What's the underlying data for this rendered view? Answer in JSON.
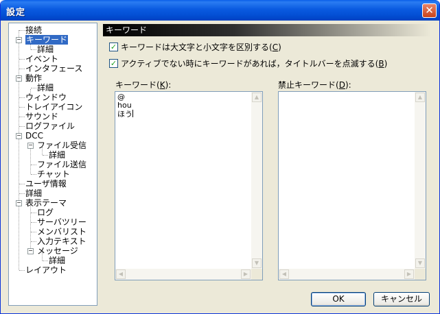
{
  "window": {
    "title": "設定"
  },
  "tree": {
    "items": [
      {
        "label": "接続"
      },
      {
        "label": "キーワード"
      },
      {
        "label": "詳細"
      },
      {
        "label": "イベント"
      },
      {
        "label": "インタフェース"
      },
      {
        "label": "動作"
      },
      {
        "label": "詳細"
      },
      {
        "label": "ウィンドウ"
      },
      {
        "label": "トレイアイコン"
      },
      {
        "label": "サウンド"
      },
      {
        "label": "ログファイル"
      },
      {
        "label": "DCC"
      },
      {
        "label": "ファイル受信"
      },
      {
        "label": "詳細"
      },
      {
        "label": "ファイル送信"
      },
      {
        "label": "チャット"
      },
      {
        "label": "ユーザ情報"
      },
      {
        "label": "詳細"
      },
      {
        "label": "表示テーマ"
      },
      {
        "label": "ログ"
      },
      {
        "label": "サーバツリー"
      },
      {
        "label": "メンバリスト"
      },
      {
        "label": "入力テキスト"
      },
      {
        "label": "メッセージ"
      },
      {
        "label": "詳細"
      },
      {
        "label": "レイアウト"
      }
    ],
    "selected": "キーワード"
  },
  "section": {
    "title": "キーワード"
  },
  "options": {
    "case_sensitive": {
      "text": "キーワードは大文字と小文字を区別する(",
      "key": "C",
      "end": ")",
      "checked": true
    },
    "blink_titlebar": {
      "text": "アクティブでない時にキーワードがあれば，タイトルバーを点滅する(",
      "key": "B",
      "end": ")",
      "checked": true
    }
  },
  "keywords": {
    "label_text": "キーワード(",
    "label_key": "K",
    "label_end": "):",
    "lines": [
      "@",
      "hou",
      "ほう"
    ]
  },
  "banned": {
    "label_text": "禁止キーワード(",
    "label_key": "D",
    "label_end": "):",
    "lines": []
  },
  "buttons": {
    "ok": "OK",
    "cancel": "キャンセル"
  }
}
